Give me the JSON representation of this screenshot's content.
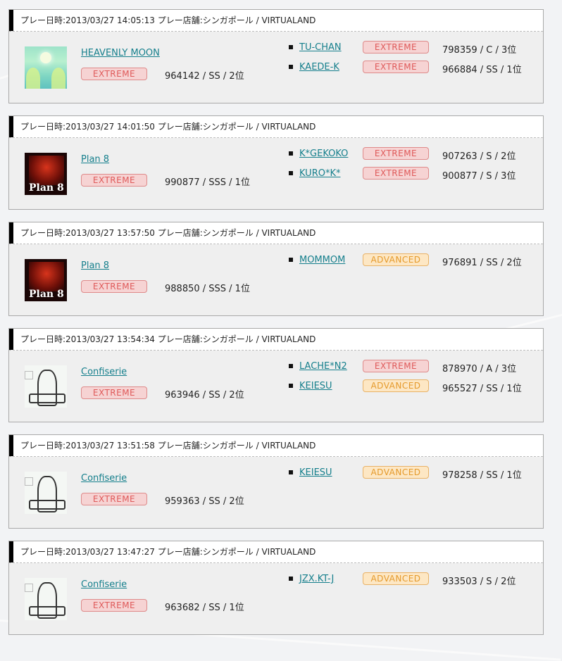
{
  "header_prefix": "プレー日時:",
  "shop_prefix": "プレー店舗:",
  "entries": [
    {
      "time": "2013/03/27 14:05:13",
      "shop": "シンガポール / VIRTUALAND",
      "jacket": "heavenly-moon-jacket",
      "song": "HEAVENLY MOON",
      "difficulty": "EXTREME",
      "result": "964142 / SS / 2位",
      "rivals": [
        {
          "name": "TU-CHAN",
          "difficulty": "EXTREME",
          "result": "798359 / C / 3位"
        },
        {
          "name": "KAEDE-K",
          "difficulty": "EXTREME",
          "result": "966884 / SS / 1位"
        }
      ]
    },
    {
      "time": "2013/03/27 14:01:50",
      "shop": "シンガポール / VIRTUALAND",
      "jacket": "plan8-jacket",
      "song": "Plan 8",
      "difficulty": "EXTREME",
      "result": "990877 / SSS / 1位",
      "rivals": [
        {
          "name": "K*GEKOKO",
          "difficulty": "EXTREME",
          "result": "907263 / S / 2位"
        },
        {
          "name": "KURO*K*",
          "difficulty": "EXTREME",
          "result": "900877 / S / 3位"
        }
      ]
    },
    {
      "time": "2013/03/27 13:57:50",
      "shop": "シンガポール / VIRTUALAND",
      "jacket": "plan8-jacket",
      "song": "Plan 8",
      "difficulty": "EXTREME",
      "result": "988850 / SSS / 1位",
      "rivals": [
        {
          "name": "MOMMOM",
          "difficulty": "ADVANCED",
          "result": "976891 / SS / 2位"
        }
      ]
    },
    {
      "time": "2013/03/27 13:54:34",
      "shop": "シンガポール / VIRTUALAND",
      "jacket": "confiserie-jacket",
      "song": "Confiserie",
      "difficulty": "EXTREME",
      "result": "963946 / SS / 2位",
      "rivals": [
        {
          "name": "LACHE*N2",
          "difficulty": "EXTREME",
          "result": "878970 / A / 3位"
        },
        {
          "name": "KEIESU",
          "difficulty": "ADVANCED",
          "result": "965527 / SS / 1位"
        }
      ]
    },
    {
      "time": "2013/03/27 13:51:58",
      "shop": "シンガポール / VIRTUALAND",
      "jacket": "confiserie-jacket",
      "song": "Confiserie",
      "difficulty": "EXTREME",
      "result": "959363 / SS / 2位",
      "rivals": [
        {
          "name": "KEIESU",
          "difficulty": "ADVANCED",
          "result": "978258 / SS / 1位"
        }
      ]
    },
    {
      "time": "2013/03/27 13:47:27",
      "shop": "シンガポール / VIRTUALAND",
      "jacket": "confiserie-jacket",
      "song": "Confiserie",
      "difficulty": "EXTREME",
      "result": "963682 / SS / 1位",
      "rivals": [
        {
          "name": "JZX.KT-J",
          "difficulty": "ADVANCED",
          "result": "933503 / S / 2位"
        }
      ]
    }
  ]
}
